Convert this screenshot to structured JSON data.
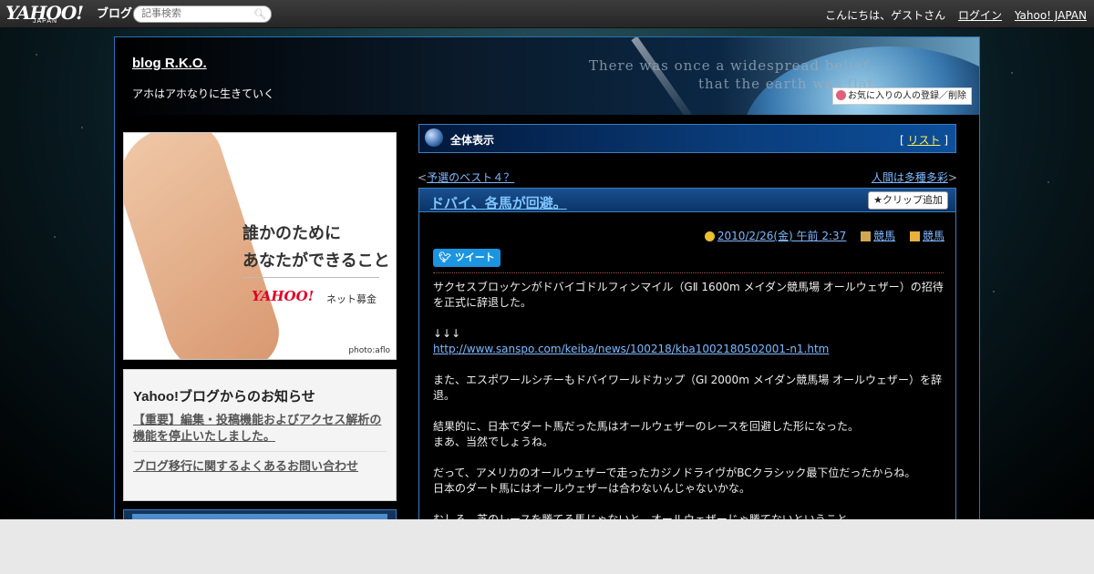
{
  "topbar": {
    "logo_yahoo": "YAHOO!",
    "logo_japan": "JAPAN",
    "logo_blog": "ブログ",
    "search_placeholder": "記事検索",
    "greeting": "こんにちは、ゲストさん",
    "login": "ログイン",
    "yahoo_japan": "Yahoo! JAPAN"
  },
  "header": {
    "blog_title": "blog R.K.O.",
    "description": "アホはアホなりに生きていく",
    "banner_text_1": "There was once a widespread belief",
    "banner_text_2": "that the earth was flat",
    "favorite_button": "お気に入りの人の登録／削除"
  },
  "sidebar": {
    "ad": {
      "line1": "誰かのために",
      "line2": "あなたができること",
      "brand": "YAHOO!",
      "brand_sub": "ネット募金",
      "credit": "photo:aflo"
    },
    "notice": {
      "title": "Yahoo!ブログからのお知らせ",
      "items": [
        "【重要】編集・投稿機能およびアクセス解析の機能を停止いたしました。",
        "ブログ移行に関するよくあるお問い合わせ"
      ]
    }
  },
  "main": {
    "bar_label": "全体表示",
    "list_open": "[",
    "list_link": "リスト",
    "list_close": "]",
    "prev_arrow": "<",
    "prev_link": "予選のベスト４？",
    "next_link": "人間は多種多彩",
    "next_arrow": ">",
    "post": {
      "title": "ドバイ、各馬が回避。",
      "clip_button": "クリップ追加",
      "date": "2010/2/26(金) 午前 2:37",
      "category1": "競馬",
      "category2": "競馬",
      "tweet": "ツイート",
      "lines": [
        "サクセスブロッケンがドバイゴドルフィンマイル（GⅡ 1600m メイダン競馬場 オールウェザー）の招待を正式に辞退した。",
        "",
        "↓↓↓",
        "http://www.sanspo.com/keiba/news/100218/kba1002180502001-n1.htm",
        "",
        "また、エスポワールシチーもドバイワールドカップ（GⅠ 2000m メイダン競馬場 オールウェザー）を辞退。",
        "",
        "結果的に、日本でダート馬だった馬はオールウェザーのレースを回避した形になった。",
        "まあ、当然でしょうね。",
        "",
        "だって、アメリカのオールウェザーで走ったカジノドライヴがBCクラシック最下位だったからね。",
        "日本のダート馬にはオールウェザーは合わないんじゃないかな。",
        "",
        "むしろ、芝のレースを勝てる馬じゃないと、オールウェザーじゃ勝てないということ。"
      ]
    }
  }
}
